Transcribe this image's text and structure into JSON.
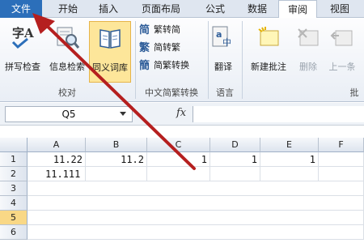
{
  "tabs": [
    {
      "label": "文件"
    },
    {
      "label": "开始"
    },
    {
      "label": "插入"
    },
    {
      "label": "页面布局"
    },
    {
      "label": "公式"
    },
    {
      "label": "数据"
    },
    {
      "label": "审阅"
    },
    {
      "label": "视图"
    }
  ],
  "ribbon": {
    "proofing": {
      "label": "校对",
      "spell": "拼写检查",
      "research": "信息检索",
      "thesaurus": "同义词库"
    },
    "chinese": {
      "label": "中文简繁转换",
      "to_simplified": "繁转简",
      "to_traditional": "简转繁",
      "convert": "简繁转换"
    },
    "language": {
      "label": "语言",
      "translate": "翻译"
    },
    "comments": {
      "label": "批",
      "new_comment": "新建批注",
      "delete": "删除",
      "previous": "上一条"
    }
  },
  "formula_bar": {
    "name_box": "Q5",
    "fx": "fx",
    "value": ""
  },
  "grid": {
    "columns": [
      "A",
      "B",
      "C",
      "D",
      "E",
      "F"
    ],
    "rows": [
      "1",
      "2",
      "3",
      "4",
      "5",
      "6"
    ],
    "cells": {
      "A1": "11.22",
      "B1": "11.2",
      "C1": "1",
      "D1": "1",
      "E1": "1",
      "A2": "11.111"
    },
    "selected_row": "5"
  },
  "colors": {
    "file_tab": "#2c6fba",
    "arrow": "#b51f1f",
    "highlight": "#fde69a"
  }
}
